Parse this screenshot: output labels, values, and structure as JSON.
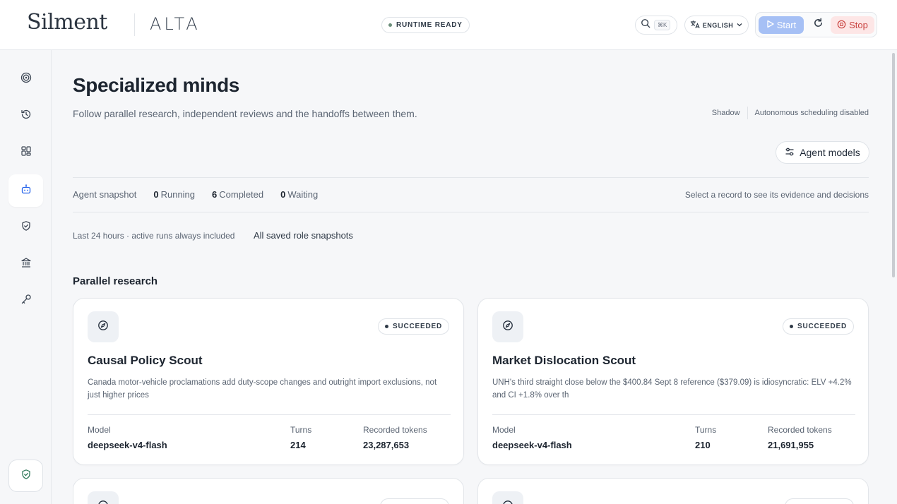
{
  "header": {
    "brand": "Silment",
    "product": "ALTA",
    "runtime_status": "RUNTIME READY",
    "search_shortcut": "⌘K",
    "language": "ENGLISH",
    "start_label": "Start",
    "stop_label": "Stop"
  },
  "sidebar": {
    "items": [
      {
        "icon": "target-icon"
      },
      {
        "icon": "history-icon"
      },
      {
        "icon": "dashboard-icon"
      },
      {
        "icon": "robot-icon",
        "active": true
      },
      {
        "icon": "shield-check-icon"
      },
      {
        "icon": "bank-icon"
      },
      {
        "icon": "key-icon"
      }
    ],
    "bottom_icon": "shield-check-icon"
  },
  "page": {
    "title": "Specialized minds",
    "subtitle": "Follow parallel research, independent reviews and the handoffs between them.",
    "mode": "Shadow",
    "scheduling": "Autonomous scheduling disabled",
    "agent_models_label": "Agent models"
  },
  "snapshot": {
    "label": "Agent snapshot",
    "running_count": "0",
    "running_label": "Running",
    "completed_count": "6",
    "completed_label": "Completed",
    "waiting_count": "0",
    "waiting_label": "Waiting",
    "hint": "Select a record to see its evidence and decisions"
  },
  "filters": {
    "window": "Last 24 hours · active runs always included",
    "all_snapshots": "All saved role snapshots"
  },
  "section_title": "Parallel research",
  "labels": {
    "model": "Model",
    "turns": "Turns",
    "tokens": "Recorded tokens"
  },
  "cards": [
    {
      "title": "Causal Policy Scout",
      "status": "SUCCEEDED",
      "description": "Canada motor-vehicle proclamations add duty-scope changes and outright import exclusions, not just higher prices",
      "model": "deepseek-v4-flash",
      "turns": "214",
      "tokens": "23,287,653"
    },
    {
      "title": "Market Dislocation Scout",
      "status": "SUCCEEDED",
      "description": "UNH's third straight close below the $400.84 Sept 8 reference ($379.09) is idiosyncratic: ELV +4.2% and CI +1.8% over th",
      "model": "deepseek-v4-flash",
      "turns": "210",
      "tokens": "21,691,955"
    }
  ]
}
